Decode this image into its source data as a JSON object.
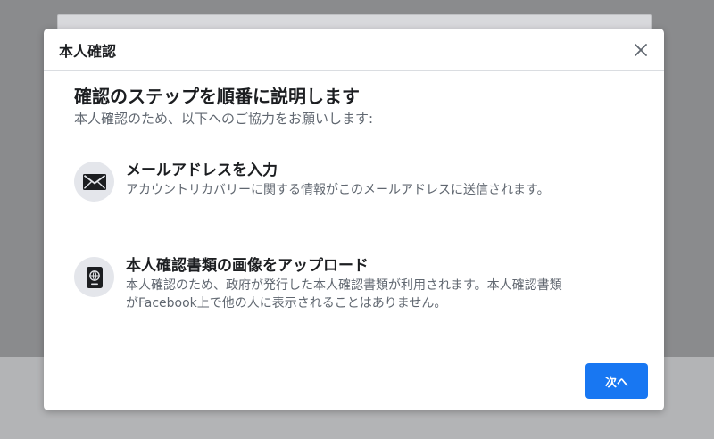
{
  "modal": {
    "title": "本人確認",
    "heading": "確認のステップを順番に説明します",
    "subheading": "本人確認のため、以下へのご協力をお願いします:",
    "steps": [
      {
        "icon": "envelope-icon",
        "title": "メールアドレスを入力",
        "description": "アカウントリカバリーに関する情報がこのメールアドレスに送信されます。"
      },
      {
        "icon": "id-document-icon",
        "title": "本人確認書類の画像をアップロード",
        "description_line1": "本人確認のため、政府が発行した本人確認書類が利用されます。本人確認書類",
        "description_line2": "がFacebook上で他の人に表示されることはありません。"
      }
    ],
    "next_label": "次へ"
  },
  "colors": {
    "accent": "#1877f2",
    "title_text": "#1c1e21",
    "secondary_text": "#606770",
    "icon_bg": "#e4e6eb"
  }
}
